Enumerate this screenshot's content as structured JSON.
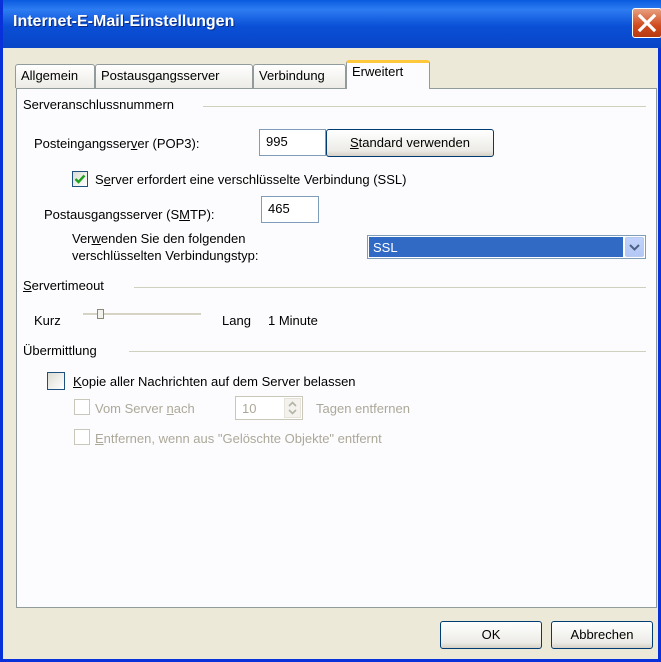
{
  "window": {
    "title": "Internet-E-Mail-Einstellungen"
  },
  "tabs": [
    {
      "label": "Allgemein"
    },
    {
      "label": "Postausgangsserver"
    },
    {
      "label": "Verbindung"
    },
    {
      "label": "Erweitert"
    }
  ],
  "server_ports": {
    "group_title": "Serveranschlussnummern",
    "pop3_label": "Posteingangsserver (POP3):",
    "pop3_value": "995",
    "default_button": "Standard verwenden",
    "ssl_checkbox_label": "Server erfordert eine verschlüsselte Verbindung (SSL)",
    "ssl_checked": true,
    "smtp_label": "Postausgangsserver (SMTP):",
    "smtp_value": "465",
    "conn_type_label_line1": "Verwenden Sie den folgenden",
    "conn_type_label_line2": "verschlüsselten Verbindungstyp:",
    "conn_type_value": "SSL"
  },
  "timeout": {
    "group_title": "Servertimeout",
    "short_label": "Kurz",
    "long_label": "Lang",
    "value_label": "1 Minute",
    "slider_level": 0.0
  },
  "delivery": {
    "group_title": "Übermittlung",
    "keep_copy_label": "Kopie aller Nachrichten auf dem Server belassen",
    "keep_copy_checked": false,
    "remove_after_label": "Vom Server nach",
    "remove_days": "10",
    "remove_days_suffix": "Tagen entfernen",
    "remove_deleted_label": "Entfernen, wenn aus \"Gelöschte Objekte\" entfernt"
  },
  "footer": {
    "ok_label": "OK",
    "cancel_label": "Abbrechen"
  }
}
